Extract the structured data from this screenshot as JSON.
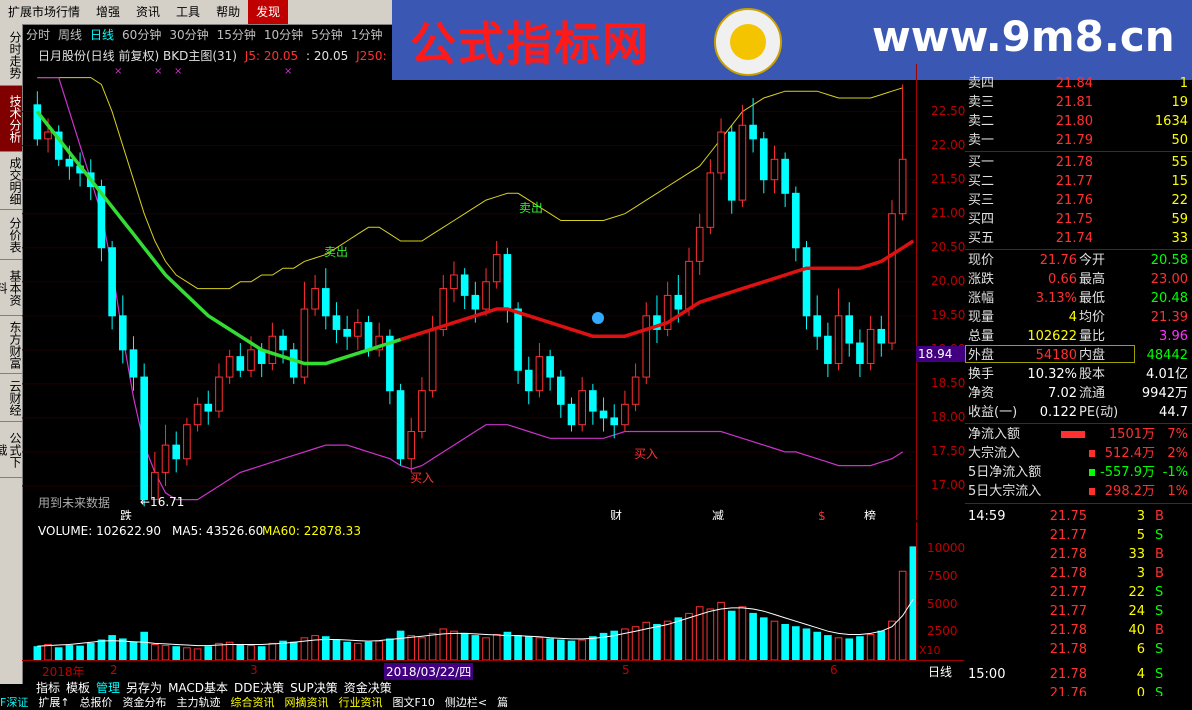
{
  "menu": [
    {
      "label": "扩展市场行情",
      "highlight": false
    },
    {
      "label": "增强",
      "highlight": false
    },
    {
      "label": "资讯",
      "highlight": false
    },
    {
      "label": "工具",
      "highlight": false
    },
    {
      "label": "帮助",
      "highlight": false
    },
    {
      "label": "发现",
      "highlight": true
    }
  ],
  "banner": {
    "cn": "公式指标网",
    "url": "www.9m8.cn"
  },
  "left_tabs": [
    {
      "label": "分时走势",
      "active": false
    },
    {
      "label": "技术分析",
      "active": true
    },
    {
      "label": "成交明细",
      "active": false
    },
    {
      "label": "分价表",
      "active": false
    },
    {
      "label": "基本资料",
      "active": false
    },
    {
      "label": "东方财富",
      "active": false
    },
    {
      "label": "云财经",
      "active": false
    },
    {
      "label": "公式下载",
      "active": false
    }
  ],
  "period_tabs": [
    {
      "label": "分时",
      "active": false
    },
    {
      "label": "周线",
      "active": false
    },
    {
      "label": "日线",
      "active": true
    },
    {
      "label": "60分钟",
      "active": false
    },
    {
      "label": "30分钟",
      "active": false
    },
    {
      "label": "15分钟",
      "active": false
    },
    {
      "label": "10分钟",
      "active": false
    },
    {
      "label": "5分钟",
      "active": false
    },
    {
      "label": "1分钟",
      "active": false
    }
  ],
  "stock": {
    "title": "日月股份(日线 前复权) BKD主图(31)",
    "j5": "J5: 20.05",
    "j5b": ": 20.05",
    "j250": "J250:"
  },
  "chart": {
    "sell_labels": [
      "卖出",
      "卖出"
    ],
    "buy_labels": [
      "买入",
      "买入"
    ],
    "low_marker": "←16.71",
    "future_note": "用到未来数据",
    "event_marks": [
      "跌",
      "财",
      "减",
      "$",
      "榜"
    ],
    "current_price_tag": "18.94",
    "price_ticks": [
      "22.50",
      "22.00",
      "21.50",
      "21.00",
      "20.50",
      "20.00",
      "19.50",
      "19.00",
      "18.50",
      "18.00",
      "17.50",
      "17.00"
    ],
    "date_labels": [
      "2018年",
      "2",
      "3",
      "2018/03/22/四",
      "5",
      "6"
    ]
  },
  "chart_data": {
    "type": "candlestick",
    "ylim": [
      16.5,
      23.2
    ],
    "candles": [
      {
        "o": 22.6,
        "c": 22.1,
        "h": 22.8,
        "l": 22.0
      },
      {
        "o": 22.1,
        "c": 22.2,
        "h": 22.4,
        "l": 21.9
      },
      {
        "o": 22.2,
        "c": 21.8,
        "h": 22.3,
        "l": 21.7
      },
      {
        "o": 21.8,
        "c": 21.7,
        "h": 22.0,
        "l": 21.5
      },
      {
        "o": 21.7,
        "c": 21.6,
        "h": 21.9,
        "l": 21.4
      },
      {
        "o": 21.6,
        "c": 21.4,
        "h": 21.8,
        "l": 21.2
      },
      {
        "o": 21.4,
        "c": 20.5,
        "h": 21.5,
        "l": 20.3
      },
      {
        "o": 20.5,
        "c": 19.5,
        "h": 20.6,
        "l": 19.3
      },
      {
        "o": 19.5,
        "c": 19.0,
        "h": 19.8,
        "l": 18.8
      },
      {
        "o": 19.0,
        "c": 18.6,
        "h": 19.2,
        "l": 18.4
      },
      {
        "o": 18.6,
        "c": 16.8,
        "h": 18.8,
        "l": 16.7
      },
      {
        "o": 16.8,
        "c": 17.2,
        "h": 17.5,
        "l": 16.9
      },
      {
        "o": 17.2,
        "c": 17.6,
        "h": 17.9,
        "l": 17.0
      },
      {
        "o": 17.6,
        "c": 17.4,
        "h": 17.8,
        "l": 17.2
      },
      {
        "o": 17.4,
        "c": 17.9,
        "h": 18.0,
        "l": 17.3
      },
      {
        "o": 17.9,
        "c": 18.2,
        "h": 18.3,
        "l": 17.8
      },
      {
        "o": 18.2,
        "c": 18.1,
        "h": 18.4,
        "l": 17.9
      },
      {
        "o": 18.1,
        "c": 18.6,
        "h": 18.8,
        "l": 18.0
      },
      {
        "o": 18.6,
        "c": 18.9,
        "h": 19.0,
        "l": 18.5
      },
      {
        "o": 18.9,
        "c": 18.7,
        "h": 19.1,
        "l": 18.6
      },
      {
        "o": 18.7,
        "c": 19.0,
        "h": 19.2,
        "l": 18.6
      },
      {
        "o": 19.0,
        "c": 18.8,
        "h": 19.1,
        "l": 18.6
      },
      {
        "o": 18.8,
        "c": 19.2,
        "h": 19.4,
        "l": 18.7
      },
      {
        "o": 19.2,
        "c": 19.0,
        "h": 19.3,
        "l": 18.8
      },
      {
        "o": 19.0,
        "c": 18.6,
        "h": 19.1,
        "l": 18.5
      },
      {
        "o": 18.6,
        "c": 19.6,
        "h": 20.0,
        "l": 18.5
      },
      {
        "o": 19.6,
        "c": 19.9,
        "h": 20.1,
        "l": 19.5
      },
      {
        "o": 19.9,
        "c": 19.5,
        "h": 20.2,
        "l": 19.3
      },
      {
        "o": 19.5,
        "c": 19.3,
        "h": 19.7,
        "l": 19.1
      },
      {
        "o": 19.3,
        "c": 19.2,
        "h": 19.5,
        "l": 19.0
      },
      {
        "o": 19.2,
        "c": 19.4,
        "h": 19.6,
        "l": 19.0
      },
      {
        "o": 19.4,
        "c": 19.0,
        "h": 19.5,
        "l": 18.9
      },
      {
        "o": 19.0,
        "c": 19.2,
        "h": 19.4,
        "l": 18.9
      },
      {
        "o": 19.2,
        "c": 18.4,
        "h": 19.3,
        "l": 18.2
      },
      {
        "o": 18.4,
        "c": 17.4,
        "h": 18.5,
        "l": 17.3
      },
      {
        "o": 17.4,
        "c": 17.8,
        "h": 18.0,
        "l": 17.2
      },
      {
        "o": 17.8,
        "c": 18.4,
        "h": 18.6,
        "l": 17.7
      },
      {
        "o": 18.4,
        "c": 19.3,
        "h": 19.5,
        "l": 18.3
      },
      {
        "o": 19.3,
        "c": 19.9,
        "h": 20.1,
        "l": 19.2
      },
      {
        "o": 19.9,
        "c": 20.1,
        "h": 20.3,
        "l": 19.7
      },
      {
        "o": 20.1,
        "c": 19.8,
        "h": 20.2,
        "l": 19.6
      },
      {
        "o": 19.8,
        "c": 19.6,
        "h": 20.0,
        "l": 19.4
      },
      {
        "o": 19.6,
        "c": 20.0,
        "h": 20.2,
        "l": 19.5
      },
      {
        "o": 20.0,
        "c": 20.4,
        "h": 20.6,
        "l": 19.9
      },
      {
        "o": 20.4,
        "c": 19.6,
        "h": 20.5,
        "l": 19.4
      },
      {
        "o": 19.6,
        "c": 18.7,
        "h": 19.7,
        "l": 18.5
      },
      {
        "o": 18.7,
        "c": 18.4,
        "h": 18.9,
        "l": 18.2
      },
      {
        "o": 18.4,
        "c": 18.9,
        "h": 19.1,
        "l": 18.3
      },
      {
        "o": 18.9,
        "c": 18.6,
        "h": 19.0,
        "l": 18.4
      },
      {
        "o": 18.6,
        "c": 18.2,
        "h": 18.7,
        "l": 18.0
      },
      {
        "o": 18.2,
        "c": 17.9,
        "h": 18.3,
        "l": 17.8
      },
      {
        "o": 17.9,
        "c": 18.4,
        "h": 18.6,
        "l": 17.8
      },
      {
        "o": 18.4,
        "c": 18.1,
        "h": 18.5,
        "l": 17.9
      },
      {
        "o": 18.1,
        "c": 18.0,
        "h": 18.3,
        "l": 17.8
      },
      {
        "o": 18.0,
        "c": 17.9,
        "h": 18.2,
        "l": 17.7
      },
      {
        "o": 17.9,
        "c": 18.2,
        "h": 18.4,
        "l": 17.8
      },
      {
        "o": 18.2,
        "c": 18.6,
        "h": 18.8,
        "l": 18.1
      },
      {
        "o": 18.6,
        "c": 19.5,
        "h": 19.7,
        "l": 18.5
      },
      {
        "o": 19.5,
        "c": 19.3,
        "h": 19.8,
        "l": 19.1
      },
      {
        "o": 19.3,
        "c": 19.8,
        "h": 20.0,
        "l": 19.2
      },
      {
        "o": 19.8,
        "c": 19.6,
        "h": 20.1,
        "l": 19.4
      },
      {
        "o": 19.6,
        "c": 20.3,
        "h": 20.5,
        "l": 19.5
      },
      {
        "o": 20.3,
        "c": 20.8,
        "h": 21.0,
        "l": 20.1
      },
      {
        "o": 20.8,
        "c": 21.6,
        "h": 21.8,
        "l": 20.7
      },
      {
        "o": 21.6,
        "c": 22.2,
        "h": 22.4,
        "l": 21.5
      },
      {
        "o": 22.2,
        "c": 21.2,
        "h": 22.3,
        "l": 21.0
      },
      {
        "o": 21.2,
        "c": 22.3,
        "h": 22.6,
        "l": 21.1
      },
      {
        "o": 22.3,
        "c": 22.1,
        "h": 22.7,
        "l": 21.9
      },
      {
        "o": 22.1,
        "c": 21.5,
        "h": 22.2,
        "l": 21.3
      },
      {
        "o": 21.5,
        "c": 21.8,
        "h": 22.0,
        "l": 21.3
      },
      {
        "o": 21.8,
        "c": 21.3,
        "h": 21.9,
        "l": 21.1
      },
      {
        "o": 21.3,
        "c": 20.5,
        "h": 21.4,
        "l": 20.3
      },
      {
        "o": 20.5,
        "c": 19.5,
        "h": 20.6,
        "l": 19.3
      },
      {
        "o": 19.5,
        "c": 19.2,
        "h": 19.8,
        "l": 19.0
      },
      {
        "o": 19.2,
        "c": 18.8,
        "h": 19.4,
        "l": 18.6
      },
      {
        "o": 18.8,
        "c": 19.5,
        "h": 19.9,
        "l": 18.7
      },
      {
        "o": 19.5,
        "c": 19.1,
        "h": 19.7,
        "l": 18.9
      },
      {
        "o": 19.1,
        "c": 18.8,
        "h": 19.3,
        "l": 18.6
      },
      {
        "o": 18.8,
        "c": 19.3,
        "h": 19.5,
        "l": 18.7
      },
      {
        "o": 19.3,
        "c": 19.1,
        "h": 19.5,
        "l": 18.9
      },
      {
        "o": 19.1,
        "c": 21.0,
        "h": 21.2,
        "l": 19.0
      },
      {
        "o": 21.0,
        "c": 21.8,
        "h": 22.9,
        "l": 20.9
      }
    ],
    "ma_green_red": [
      22.5,
      22.3,
      22.1,
      21.9,
      21.7,
      21.5,
      21.3,
      21.1,
      20.9,
      20.7,
      20.5,
      20.3,
      20.1,
      19.95,
      19.8,
      19.65,
      19.5,
      19.4,
      19.3,
      19.2,
      19.1,
      19.0,
      18.95,
      18.9,
      18.85,
      18.8,
      18.8,
      18.8,
      18.85,
      18.9,
      18.95,
      19.0,
      19.05,
      19.1,
      19.15,
      19.2,
      19.25,
      19.3,
      19.35,
      19.4,
      19.45,
      19.5,
      19.55,
      19.6,
      19.6,
      19.55,
      19.5,
      19.45,
      19.4,
      19.35,
      19.3,
      19.25,
      19.2,
      19.2,
      19.2,
      19.2,
      19.25,
      19.3,
      19.35,
      19.4,
      19.5,
      19.6,
      19.7,
      19.75,
      19.8,
      19.85,
      19.9,
      19.95,
      20.0,
      20.05,
      20.1,
      20.15,
      20.2,
      20.2,
      20.2,
      20.2,
      20.2,
      20.2,
      20.25,
      20.3,
      20.4,
      20.5,
      20.6
    ],
    "red_from_index": 34,
    "upper_band": [
      23.0,
      23.0,
      23.0,
      23.0,
      23.0,
      23.0,
      22.9,
      22.5,
      22.0,
      21.5,
      21.0,
      20.6,
      20.3,
      20.1,
      20.0,
      19.9,
      19.9,
      19.9,
      19.9,
      20.0,
      20.0,
      20.1,
      20.1,
      20.2,
      20.2,
      20.3,
      20.35,
      20.4,
      20.5,
      20.6,
      20.7,
      20.8,
      20.8,
      20.7,
      20.6,
      20.6,
      20.6,
      20.7,
      20.8,
      20.9,
      21.0,
      21.1,
      21.2,
      21.25,
      21.3,
      21.3,
      21.2,
      21.1,
      21.0,
      20.9,
      20.9,
      20.9,
      20.9,
      20.9,
      20.95,
      21.0,
      21.1,
      21.2,
      21.3,
      21.4,
      21.5,
      21.6,
      21.7,
      21.9,
      22.1,
      22.3,
      22.5,
      22.6,
      22.7,
      22.75,
      22.8,
      22.8,
      22.8,
      22.8,
      22.75,
      22.7,
      22.7,
      22.7,
      22.7,
      22.75,
      22.8,
      22.85,
      22.9
    ],
    "lower_band": [
      23.0,
      23.0,
      23.0,
      22.5,
      22.0,
      21.5,
      21.0,
      20.2,
      19.2,
      18.3,
      17.6,
      17.2,
      16.9,
      16.8,
      16.8,
      16.8,
      16.9,
      17.0,
      17.1,
      17.2,
      17.25,
      17.3,
      17.35,
      17.4,
      17.45,
      17.5,
      17.55,
      17.6,
      17.6,
      17.6,
      17.55,
      17.5,
      17.45,
      17.4,
      17.3,
      17.25,
      17.3,
      17.4,
      17.5,
      17.6,
      17.7,
      17.8,
      17.9,
      17.9,
      17.9,
      17.85,
      17.8,
      17.75,
      17.7,
      17.7,
      17.7,
      17.7,
      17.7,
      17.7,
      17.75,
      17.8,
      17.8,
      17.8,
      17.8,
      17.8,
      17.8,
      17.8,
      17.8,
      17.8,
      17.8,
      17.75,
      17.7,
      17.65,
      17.6,
      17.55,
      17.5,
      17.5,
      17.45,
      17.4,
      17.35,
      17.3,
      17.3,
      17.3,
      17.3,
      17.35,
      17.4,
      17.5,
      17.6
    ],
    "volume": {
      "label": "VOLUME: 102622.90",
      "ma5_label": "MA5: 43526.60",
      "ma60_label": "MA60: 22878.33",
      "ticks": [
        "10000",
        "7500",
        "5000",
        "2500"
      ],
      "ylim": [
        0,
        11000
      ],
      "scale_note": "X10",
      "values": [
        1200,
        1400,
        1100,
        1300,
        1250,
        1500,
        1800,
        2200,
        1900,
        1600,
        2500,
        1400,
        1300,
        1200,
        1100,
        1000,
        1200,
        1500,
        1600,
        1400,
        1300,
        1200,
        1500,
        1700,
        1600,
        2000,
        2200,
        2100,
        1800,
        1600,
        1500,
        1600,
        1700,
        1900,
        2600,
        2200,
        2000,
        2400,
        2800,
        2600,
        2400,
        2200,
        2000,
        2300,
        2500,
        2200,
        2100,
        2000,
        1900,
        1800,
        1700,
        1800,
        2100,
        2400,
        2600,
        2800,
        3000,
        3400,
        3200,
        3500,
        3800,
        4200,
        4800,
        4600,
        5200,
        4400,
        4800,
        4200,
        3800,
        3500,
        3200,
        3000,
        2800,
        2500,
        2200,
        2000,
        1900,
        2100,
        2300,
        2600,
        3500,
        8000,
        10200
      ],
      "ma5": [
        1250,
        1300,
        1350,
        1400,
        1500,
        1600,
        1700,
        1750,
        1700,
        1650,
        1600,
        1500,
        1450,
        1400,
        1350,
        1300,
        1300,
        1350,
        1400,
        1400,
        1400,
        1400,
        1450,
        1500,
        1600,
        1700,
        1800,
        1850,
        1850,
        1800,
        1750,
        1700,
        1750,
        1850,
        1950,
        2050,
        2150,
        2250,
        2350,
        2400,
        2400,
        2350,
        2300,
        2250,
        2200,
        2200,
        2150,
        2100,
        2000,
        1950,
        1900,
        1900,
        1950,
        2050,
        2200,
        2400,
        2600,
        2800,
        3000,
        3200,
        3500,
        3800,
        4100,
        4400,
        4600,
        4700,
        4700,
        4600,
        4400,
        4100,
        3800,
        3500,
        3200,
        2900,
        2600,
        2400,
        2300,
        2300,
        2400,
        2600,
        3000,
        4000,
        5500
      ]
    }
  },
  "quote": {
    "sell": [
      {
        "label": "卖四",
        "price": "21.84",
        "vol": "1"
      },
      {
        "label": "卖三",
        "price": "21.81",
        "vol": "19"
      },
      {
        "label": "卖二",
        "price": "21.80",
        "vol": "1634"
      },
      {
        "label": "卖一",
        "price": "21.79",
        "vol": "50"
      }
    ],
    "buy": [
      {
        "label": "买一",
        "price": "21.78",
        "vol": "55"
      },
      {
        "label": "买二",
        "price": "21.77",
        "vol": "15"
      },
      {
        "label": "买三",
        "price": "21.76",
        "vol": "22"
      },
      {
        "label": "买四",
        "price": "21.75",
        "vol": "59"
      },
      {
        "label": "买五",
        "price": "21.74",
        "vol": "33"
      }
    ],
    "stats": [
      {
        "l1": "现价",
        "v1": "21.76",
        "c1": "red",
        "l2": "今开",
        "v2": "20.58",
        "c2": "grn"
      },
      {
        "l1": "涨跌",
        "v1": "0.66",
        "c1": "red",
        "l2": "最高",
        "v2": "23.00",
        "c2": "red"
      },
      {
        "l1": "涨幅",
        "v1": "3.13%",
        "c1": "red",
        "l2": "最低",
        "v2": "20.48",
        "c2": "grn"
      },
      {
        "l1": "现量",
        "v1": "4",
        "c1": "yel",
        "l2": "均价",
        "v2": "21.39",
        "c2": "red"
      },
      {
        "l1": "总量",
        "v1": "102622",
        "c1": "yel",
        "l2": "量比",
        "v2": "3.96",
        "c2": "mag"
      },
      {
        "l1": "外盘",
        "v1": "54180",
        "c1": "red",
        "l2": "内盘",
        "v2": "48442",
        "c2": "grn"
      },
      {
        "l1": "换手",
        "v1": "10.32%",
        "c1": "wht",
        "l2": "股本",
        "v2": "4.01亿",
        "c2": "wht"
      },
      {
        "l1": "净资",
        "v1": "7.02",
        "c1": "wht",
        "l2": "流通",
        "v2": "9942万",
        "c2": "wht"
      },
      {
        "l1": "收益(一)",
        "v1": "0.122",
        "c1": "wht",
        "l2": "PE(动)",
        "v2": "44.7",
        "c2": "wht"
      }
    ],
    "flows": [
      {
        "label": "净流入额",
        "val": "1501万",
        "pct": "7%",
        "color": "red"
      },
      {
        "label": "大宗流入",
        "val": "512.4万",
        "pct": "2%",
        "color": "red"
      },
      {
        "label": "5日净流入额",
        "val": "-557.9万",
        "pct": "-1%",
        "color": "grn"
      },
      {
        "label": "5日大宗流入",
        "val": "298.2万",
        "pct": "1%",
        "color": "red"
      }
    ],
    "ticks": [
      {
        "time": "14:59",
        "price": "21.75",
        "vol": "3",
        "side": "B"
      },
      {
        "time": "",
        "price": "21.77",
        "vol": "5",
        "side": "S"
      },
      {
        "time": "",
        "price": "21.78",
        "vol": "33",
        "side": "B"
      },
      {
        "time": "",
        "price": "21.78",
        "vol": "3",
        "side": "B"
      },
      {
        "time": "",
        "price": "21.77",
        "vol": "22",
        "side": "S"
      },
      {
        "time": "",
        "price": "21.77",
        "vol": "24",
        "side": "S"
      },
      {
        "time": "",
        "price": "21.78",
        "vol": "40",
        "side": "B"
      },
      {
        "time": "",
        "price": "21.78",
        "vol": "6",
        "side": "S"
      },
      {
        "time": "15:00",
        "price": "21.78",
        "vol": "4",
        "side": "S"
      },
      {
        "time": "",
        "price": "21.76",
        "vol": "0",
        "side": "S"
      }
    ],
    "rixian": "日线"
  },
  "funcbar": [
    "指标",
    "模板",
    "管理",
    "另存为",
    "MACD基本",
    "DDE决策",
    "SUP决策",
    "资金决策"
  ],
  "status": [
    "F深证",
    "扩展↑",
    "总报价",
    "资金分布",
    "主力轨迹",
    "综合资讯",
    "网摘资讯",
    "行业资讯",
    "图文F10",
    "侧边栏<",
    "篇"
  ],
  "colors": {
    "up": "#ff3030",
    "down": "#00ffff",
    "ma_down": "#33dd33",
    "ma_up": "#dd1111",
    "upper": "#d8d020",
    "lower": "#cc33cc",
    "axis": "#a00000"
  }
}
